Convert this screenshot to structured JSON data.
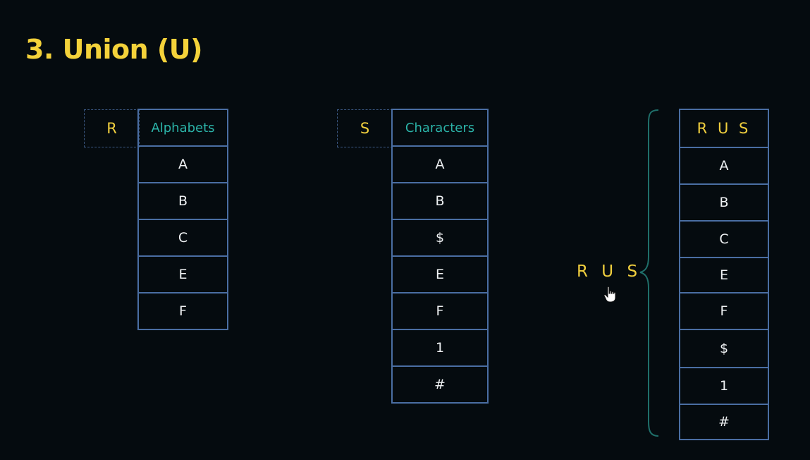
{
  "title": "3. Union (U)",
  "table_r": {
    "label": "R",
    "header": "Alphabets",
    "rows": [
      "A",
      "B",
      "C",
      "E",
      "F"
    ]
  },
  "table_s": {
    "label": "S",
    "header": "Characters",
    "rows": [
      "A",
      "B",
      "$",
      "E",
      "F",
      "1",
      "#"
    ]
  },
  "result": {
    "label": "R U S",
    "header": "R U S",
    "rows": [
      "A",
      "B",
      "C",
      "E",
      "F",
      "$",
      "1",
      "#"
    ]
  },
  "colors": {
    "background": "#050b0f",
    "title": "#f4d23a",
    "header_teal": "#2bb3a8",
    "border": "#4a6ea3",
    "label_yellow": "#f0cf3e"
  },
  "icons": [
    "hand-pointer-icon",
    "curly-brace"
  ]
}
